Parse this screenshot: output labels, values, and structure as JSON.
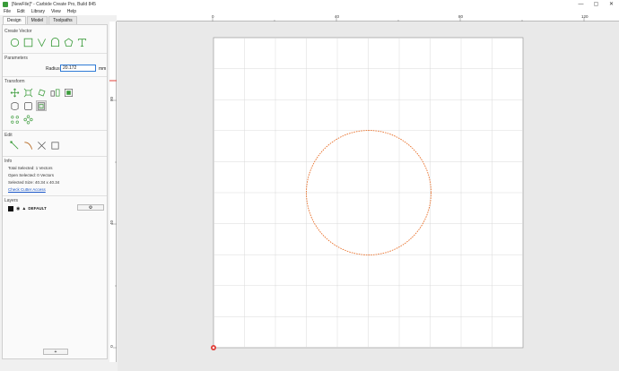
{
  "window": {
    "title": "[NewFile]* - Carbide Create Pro, Build 845",
    "minimize": "—",
    "maximize": "▢",
    "close": "✕"
  },
  "menu": [
    "File",
    "Edit",
    "Library",
    "View",
    "Help"
  ],
  "tabs": [
    "Design",
    "Model",
    "Toolpaths"
  ],
  "sections": {
    "create_vector": "Create Vector",
    "parameters": "Parameters",
    "transform": "Transform",
    "edit": "Edit",
    "info": "Info",
    "layers": "Layers"
  },
  "parameters": {
    "radius_label": "Radius:",
    "radius_value": "20.172",
    "unit": "mm"
  },
  "info": {
    "total_selected": "Total Selected:  1 Vectors",
    "open_selected": "Open Selected:  0 Vectors",
    "selected_size": "Selected Size:    40.34 x 40.34",
    "check_link": "Check Cutter Access"
  },
  "layers": {
    "name": "DEFAULT",
    "gear": "⚙",
    "add": "+"
  },
  "ruler": {
    "top_labels": [
      "0",
      "40",
      "80",
      "120"
    ],
    "left_labels": [
      "80",
      "40",
      "0"
    ]
  },
  "colors": {
    "accent_green": "#3a9b3a",
    "circle": "#e8702a",
    "grid": "#d9d9d9"
  },
  "icons": {
    "create_vector": [
      "circle-icon",
      "rectangle-icon",
      "polyline-icon",
      "arch-icon",
      "polygon-icon",
      "text-icon"
    ],
    "transform": [
      "move-icon",
      "scale-icon",
      "rotate-icon",
      "mirror-icon",
      "align-icon",
      "offset-icon",
      "boolean-icon",
      "fillet-icon",
      "array-icon",
      "circular-array-icon"
    ],
    "edit": [
      "node-edit-icon",
      "trim-icon",
      "cut-icon",
      "bounding-box-icon"
    ]
  }
}
